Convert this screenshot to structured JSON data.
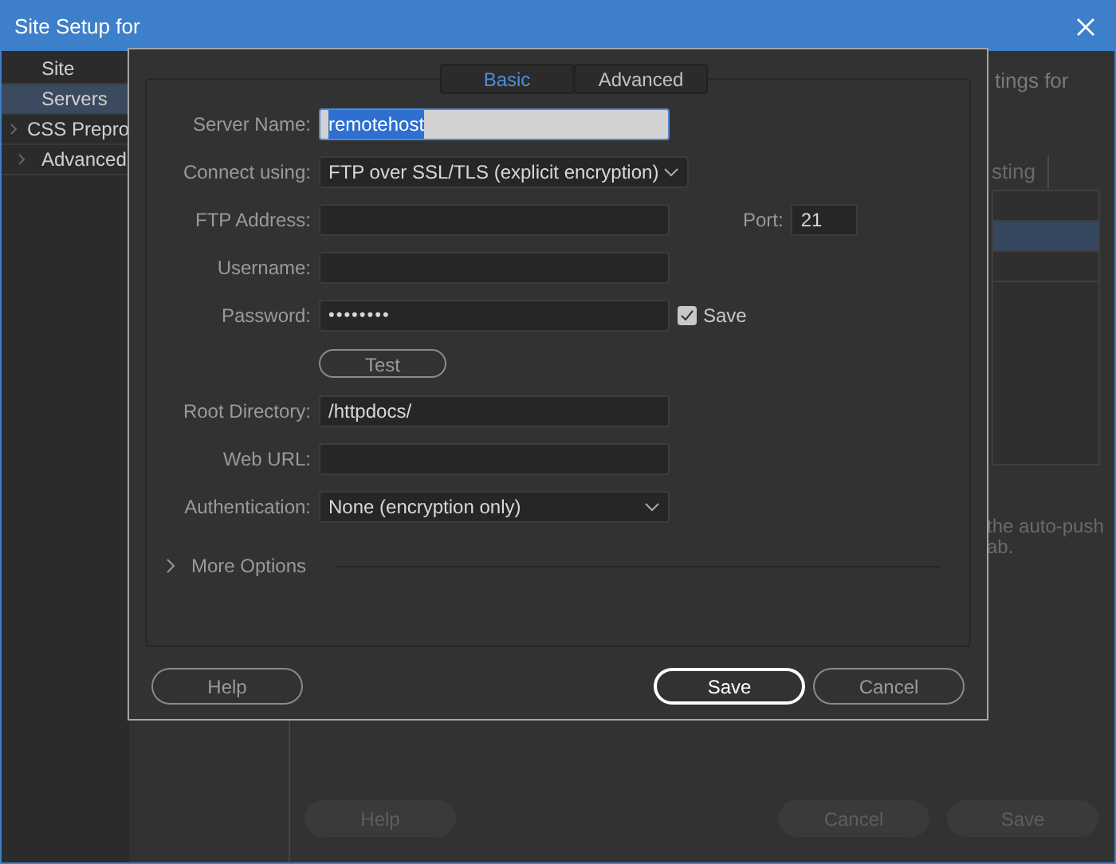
{
  "window": {
    "title": "Site Setup for"
  },
  "sidebar": {
    "items": [
      {
        "label": "Site",
        "selected": false,
        "expandable": false
      },
      {
        "label": "Servers",
        "selected": true,
        "expandable": false
      },
      {
        "label": "CSS Prepro",
        "selected": false,
        "expandable": true
      },
      {
        "label": "Advanced",
        "selected": false,
        "expandable": true
      }
    ]
  },
  "background": {
    "heading_fragments": [
      "tings for"
    ],
    "tab_fragment": "sting",
    "rows": [
      {
        "selected": false
      },
      {
        "selected": true
      },
      {
        "selected": false
      }
    ],
    "note_fragments": [
      "the auto-push",
      "ab."
    ],
    "buttons": [
      "Help",
      "Cancel",
      "Save"
    ]
  },
  "dialog": {
    "tabs": [
      {
        "label": "Basic",
        "selected": true
      },
      {
        "label": "Advanced",
        "selected": false
      }
    ],
    "fields": [
      {
        "kind": "text",
        "label": "Server Name:",
        "value": "remotehost",
        "focused": true
      },
      {
        "kind": "select",
        "label": "Connect using:",
        "value": "FTP over SSL/TLS (explicit encryption)"
      },
      {
        "kind": "text",
        "label": "FTP Address:",
        "port_label": "Port:",
        "port": "21"
      },
      {
        "kind": "text",
        "label": "Username:"
      },
      {
        "kind": "password",
        "label": "Password:",
        "value": "••••••••",
        "save_label": "Save",
        "save_checked": true
      },
      {
        "kind": "button",
        "label": "Test"
      },
      {
        "kind": "text",
        "label": "Root Directory:",
        "value": "/httpdocs/"
      },
      {
        "kind": "text",
        "label": "Web URL:"
      },
      {
        "kind": "select",
        "label": "Authentication:",
        "value": "None (encryption only)"
      }
    ],
    "more_options": {
      "label": "More Options",
      "expanded": false
    },
    "buttons": [
      {
        "label": "Help",
        "default": false
      },
      {
        "label": "Save",
        "default": true
      },
      {
        "label": "Cancel",
        "default": false
      }
    ]
  }
}
